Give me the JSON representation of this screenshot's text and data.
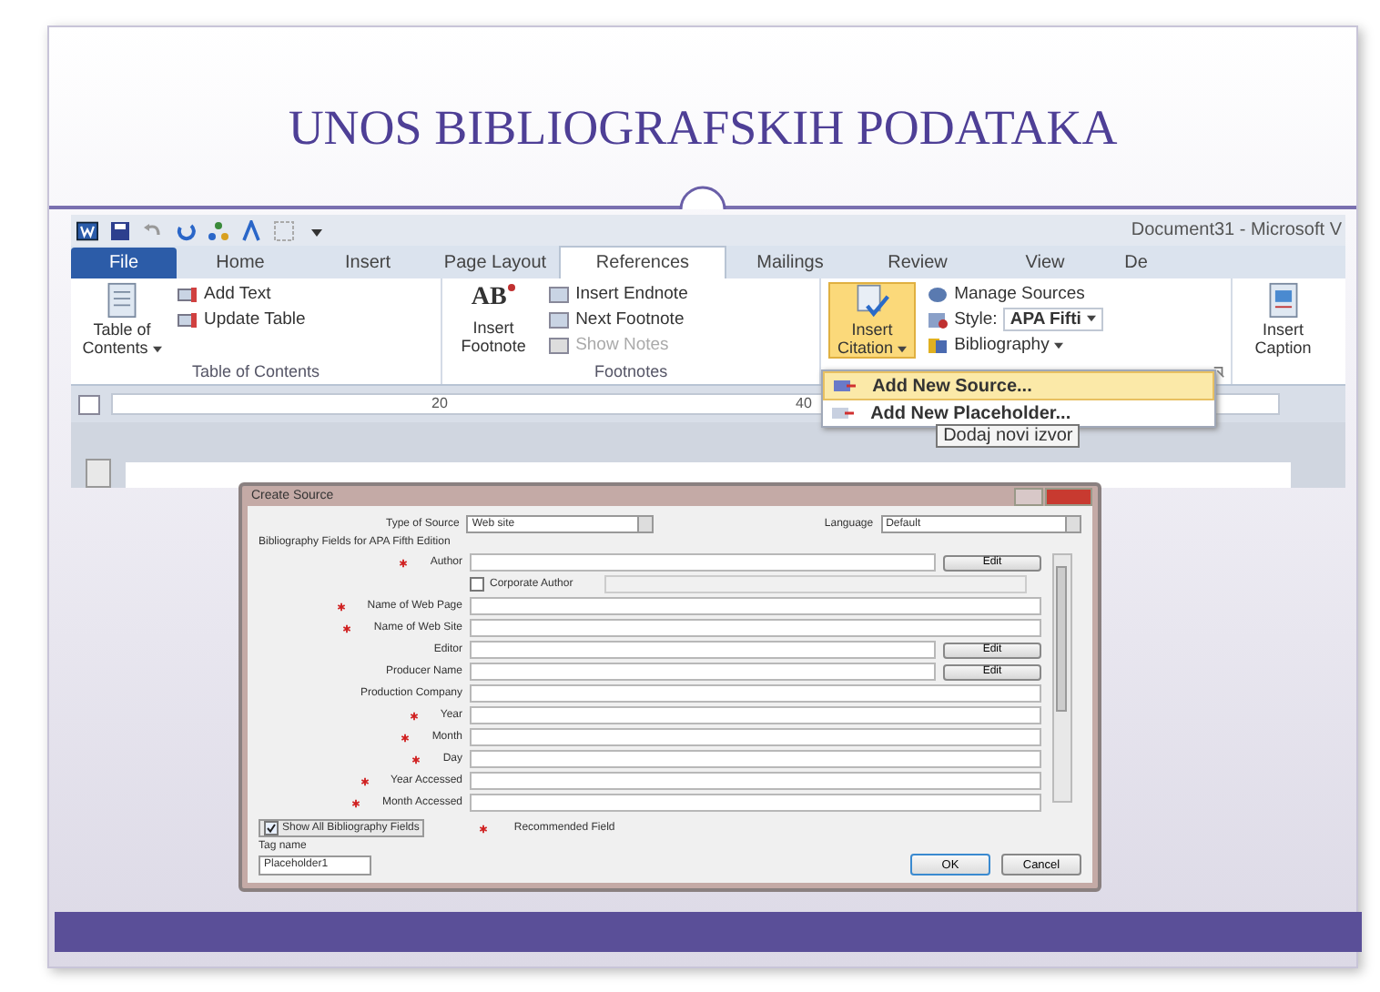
{
  "slide": {
    "title": "UNOS BIBLIOGRAFSKIH PODATAKA"
  },
  "word_window": {
    "title": "Document31 - Microsoft V",
    "tabs": [
      {
        "label": "File",
        "kind": "file",
        "selected": false
      },
      {
        "label": "Home",
        "kind": "tab",
        "selected": false
      },
      {
        "label": "Insert",
        "kind": "tab",
        "selected": false
      },
      {
        "label": "Page Layout",
        "kind": "tab",
        "selected": false
      },
      {
        "label": "References",
        "kind": "tab",
        "selected": true
      },
      {
        "label": "Mailings",
        "kind": "tab",
        "selected": false
      },
      {
        "label": "Review",
        "kind": "tab",
        "selected": false
      },
      {
        "label": "View",
        "kind": "tab",
        "selected": false
      },
      {
        "label": "De",
        "kind": "tab",
        "selected": false
      }
    ],
    "toc_group": {
      "big_button": "Table of Contents",
      "small_buttons": [
        "Add Text",
        "Update Table"
      ],
      "label": "Table of Contents"
    },
    "footnotes_group": {
      "icon_text": "AB",
      "big_button": "Insert Footnote",
      "small_buttons": [
        {
          "label": "Insert Endnote",
          "disabled": false
        },
        {
          "label": "Next Footnote",
          "disabled": false
        },
        {
          "label": "Show Notes",
          "disabled": true
        }
      ],
      "label": "Footnotes"
    },
    "citations_group": {
      "big_button": "Insert Citation",
      "manage": "Manage Sources",
      "style_label": "Style:",
      "style_value": "APA Fifti",
      "bibliography": "Bibliography"
    },
    "caption_button": "Insert Caption",
    "ruler": [
      "20",
      "40"
    ],
    "citation_menu": [
      {
        "label": "Add New Source...",
        "selected": true
      },
      {
        "label": "Add New Placeholder...",
        "selected": false
      }
    ],
    "tooltip": "Dodaj novi izvor"
  },
  "dialog": {
    "title": "Create Source",
    "type_label": "Type of Source",
    "type_value": "Web site",
    "language_label": "Language",
    "language_value": "Default",
    "fields_heading": "Bibliography Fields for APA Fifth Edition",
    "fields": [
      {
        "label": "Author",
        "recommended": true,
        "edit": "Edit"
      },
      {
        "label": "Corporate Author",
        "kind": "checkbox",
        "checked": false
      },
      {
        "label": "Name of Web Page",
        "recommended": true
      },
      {
        "label": "Name of Web Site",
        "recommended": true
      },
      {
        "label": "Editor",
        "recommended": false,
        "edit": "Edit"
      },
      {
        "label": "Producer Name",
        "recommended": false,
        "edit": "Edit"
      },
      {
        "label": "Production Company",
        "recommended": false
      },
      {
        "label": "Year",
        "recommended": true
      },
      {
        "label": "Month",
        "recommended": true
      },
      {
        "label": "Day",
        "recommended": true
      },
      {
        "label": "Year Accessed",
        "recommended": true
      },
      {
        "label": "Month Accessed",
        "recommended": true
      }
    ],
    "show_all": {
      "label": "Show All Bibliography Fields",
      "checked": true
    },
    "legend": "Recommended Field",
    "tag_label": "Tag name",
    "tag_value": "Placeholder1",
    "buttons": [
      "OK",
      "Cancel"
    ]
  }
}
